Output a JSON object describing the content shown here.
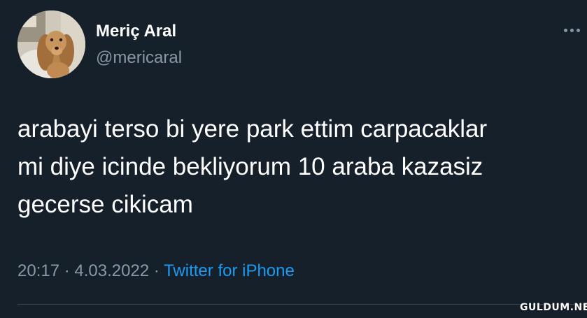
{
  "user": {
    "display_name": "Meriç Aral",
    "handle": "@mericaral",
    "avatar_icon": "dog-avatar"
  },
  "tweet": {
    "lines": [
      "arabayi terso bi yere park ettim carpacaklar",
      "mi diye icinde bekliyorum 10 araba kazasiz",
      "gecerse cikicam"
    ],
    "time": "20:17",
    "separator": "·",
    "date": "4.03.2022",
    "source": "Twitter for iPhone"
  },
  "menu": {
    "icon": "more-options-icon"
  },
  "watermark": "GULDUM.NET",
  "colors": {
    "background": "#15202b",
    "text": "#ffffff",
    "secondary": "#8899a6",
    "link": "#1d9bf0"
  }
}
